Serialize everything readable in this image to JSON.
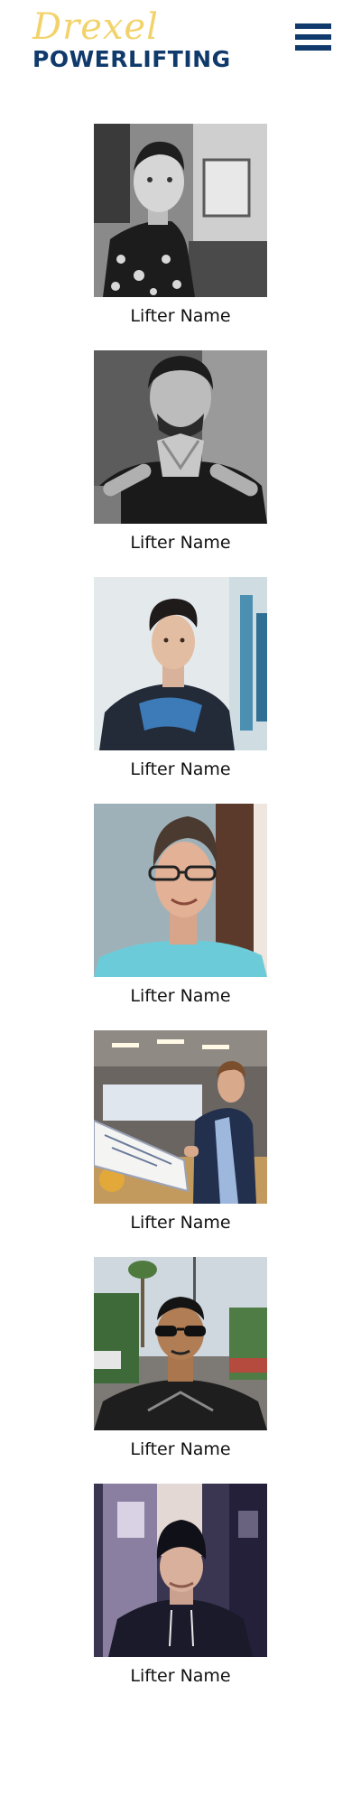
{
  "header": {
    "logo_script": "Drexel",
    "logo_main": "POWERLIFTING",
    "menu_icon": "hamburger-menu-icon"
  },
  "colors": {
    "brand_gold": "#f2d36b",
    "brand_navy": "#0f3a6b"
  },
  "lifters": [
    {
      "name": "Lifter Name",
      "photo": "black-and-white portrait of young man in floral shirt"
    },
    {
      "name": "Lifter Name",
      "photo": "black-and-white portrait of man with hands clasped"
    },
    {
      "name": "Lifter Name",
      "photo": "portrait of young man in dark sweater, light background"
    },
    {
      "name": "Lifter Name",
      "photo": "portrait of man with glasses in teal shirt"
    },
    {
      "name": "Lifter Name",
      "photo": "man in suit holding large check in conference room"
    },
    {
      "name": "Lifter Name",
      "photo": "man in sunglasses outdoors with palm trees"
    },
    {
      "name": "Lifter Name",
      "photo": "man in beanie and dark hoodie indoors"
    }
  ]
}
